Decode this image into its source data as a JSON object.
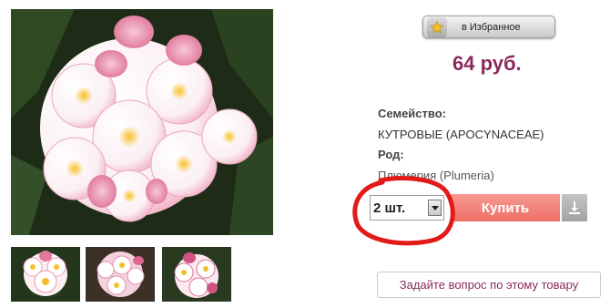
{
  "favorites": {
    "label": "в Избранное",
    "icon": "star-icon"
  },
  "price": "64 руб.",
  "specs": {
    "family_label": "Семейство:",
    "family_value": "КУТРОВЫЕ (APOCYNACEAE)",
    "genus_label": "Род:",
    "genus_value": "Плюмерия (Plumeria)"
  },
  "purchase": {
    "quantity": "2 шт.",
    "buy_label": "Купить",
    "download_icon": "download-icon"
  },
  "ask_question_label": "Задайте вопрос по этому товару",
  "colors": {
    "price": "#8a2a5c",
    "buy_button": "#ee6f66",
    "highlight_circle": "#e21a1a"
  }
}
